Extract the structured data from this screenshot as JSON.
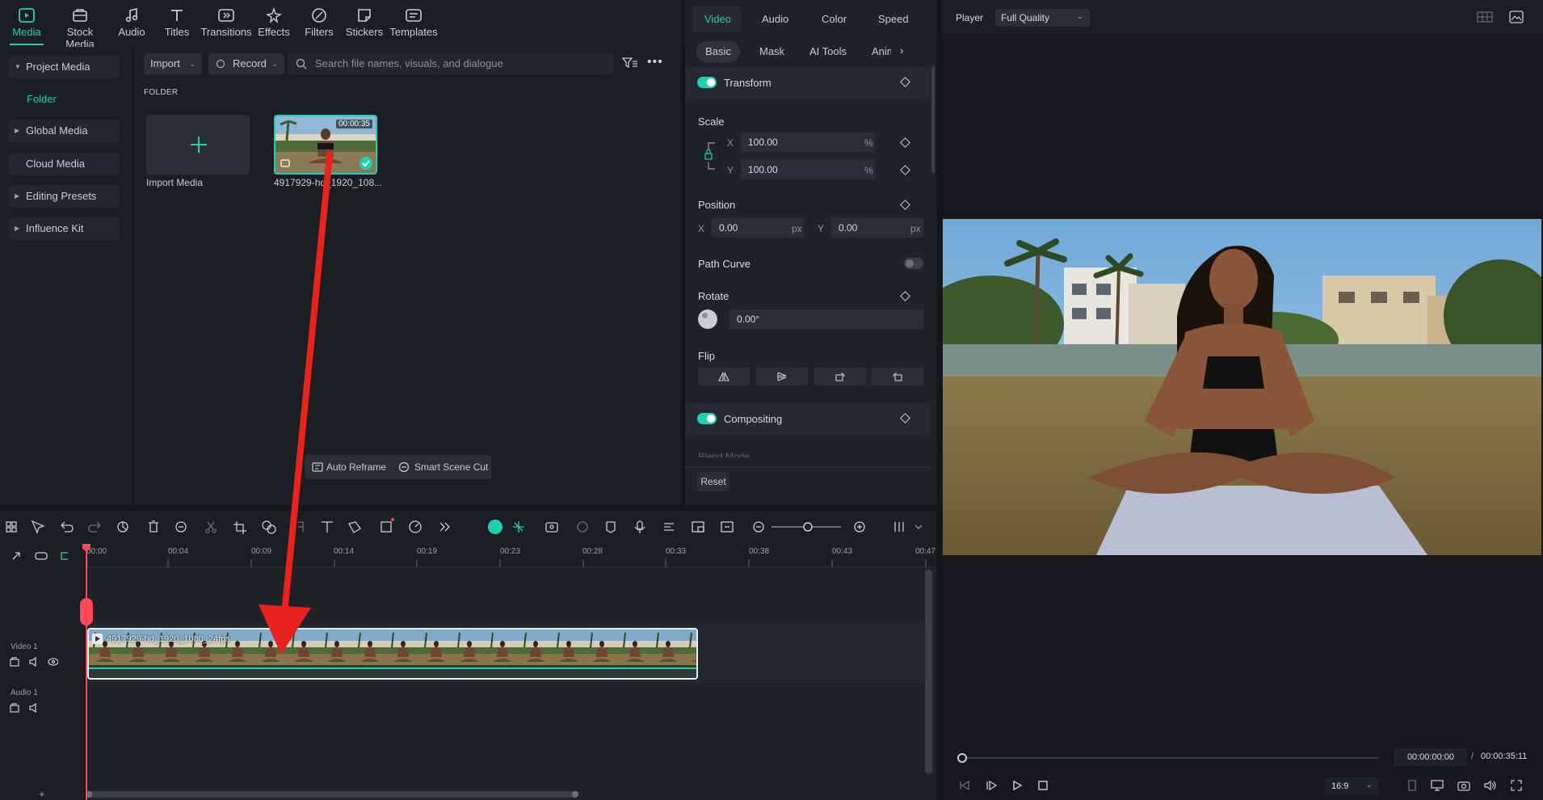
{
  "top_tabs": [
    {
      "label": "Media",
      "icon": "media-icon",
      "active": true
    },
    {
      "label": "Stock Media",
      "icon": "stock-media-icon"
    },
    {
      "label": "Audio",
      "icon": "music-note-icon"
    },
    {
      "label": "Titles",
      "icon": "titles-icon"
    },
    {
      "label": "Transitions",
      "icon": "transitions-icon"
    },
    {
      "label": "Effects",
      "icon": "effects-icon"
    },
    {
      "label": "Filters",
      "icon": "filters-icon"
    },
    {
      "label": "Stickers",
      "icon": "stickers-icon"
    },
    {
      "label": "Templates",
      "icon": "templates-icon"
    }
  ],
  "sidebar": {
    "items": [
      {
        "label": "Project Media"
      },
      {
        "label": "Global Media"
      },
      {
        "label": "Cloud Media"
      },
      {
        "label": "Editing Presets"
      },
      {
        "label": "Influence Kit"
      }
    ],
    "folder": "Folder"
  },
  "media": {
    "import_btn": "Import",
    "record_btn": "Record",
    "search_placeholder": "Search file names, visuals, and dialogue",
    "folder_label": "FOLDER",
    "import_media": "Import Media",
    "clip_duration": "00:00:35",
    "clip_name": "4917929-hd_1920_108...",
    "auto_reframe": "Auto Reframe",
    "smart_scene_cut": "Smart Scene Cut"
  },
  "props": {
    "tabs": [
      "Video",
      "Audio",
      "Color",
      "Speed"
    ],
    "subtabs": [
      "Basic",
      "Mask",
      "AI Tools",
      "Anim"
    ],
    "transform": "Transform",
    "scale": "Scale",
    "scale_x": "100.00",
    "scale_y": "100.00",
    "percent": "%",
    "x": "X",
    "y": "Y",
    "position": "Position",
    "pos_x": "0.00",
    "pos_y": "0.00",
    "px": "px",
    "path_curve": "Path Curve",
    "rotate": "Rotate",
    "rotate_val": "0.00°",
    "flip": "Flip",
    "compositing": "Compositing",
    "blend_mode": "Blend Mode",
    "reset": "Reset"
  },
  "player": {
    "label": "Player",
    "quality": "Full Quality",
    "current_time": "00:00:00:00",
    "separator": "/",
    "total_time": "00:00:35:11",
    "aspect": "16:9"
  },
  "timeline": {
    "ticks": [
      "00:00",
      "00:04",
      "00:09",
      "00:14",
      "00:19",
      "00:23",
      "00:28",
      "00:33",
      "00:38",
      "00:43",
      "00:47"
    ],
    "video_track": "Video 1",
    "audio_track": "Audio 1",
    "clip_title": "4917929-hd_1920_1080_24fps"
  },
  "colors": {
    "accent": "#1fd1b1",
    "annotation_arrow": "#e8231e",
    "playhead": "#ff4a56"
  }
}
